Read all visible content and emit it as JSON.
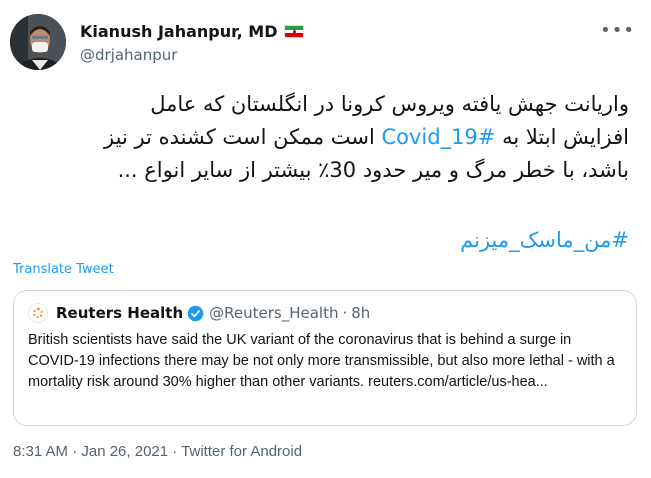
{
  "author": {
    "display_name": "Kianush Jahanpur, MD",
    "handle": "@drjahanpur"
  },
  "tweet": {
    "line1": "واریانت جهش یافته ویروس کرونا در انگلستان که عامل",
    "line2_after": " است ممکن است کشنده تر نیز",
    "line2_hashtag": "#Covid_19",
    "line2_before": "افزایش ابتلا به ",
    "line3": "باشد، با خطر مرگ و میر حدود 30٪ بیشتر از سایر انواع ...",
    "hashtag": "#من_ماسک_میزنم"
  },
  "translate_label": "Translate Tweet",
  "quoted_tweet": {
    "name": "Reuters Health",
    "handle": "@Reuters_Health",
    "separator": "·",
    "time": "8h",
    "text": "British scientists have said the UK variant of the coronavirus that is behind a surge in COVID-19 infections there may be not only more transmissible, but also more lethal - with a mortality risk around 30% higher than other variants. reuters.com/article/us-hea..."
  },
  "footer": {
    "timestamp": "8:31 AM · Jan 26, 2021",
    "source": "Twitter for Android",
    "separator": " · "
  },
  "colors": {
    "link": "#1d9bf0",
    "secondary_text": "#536471",
    "border": "#cfd9de"
  }
}
